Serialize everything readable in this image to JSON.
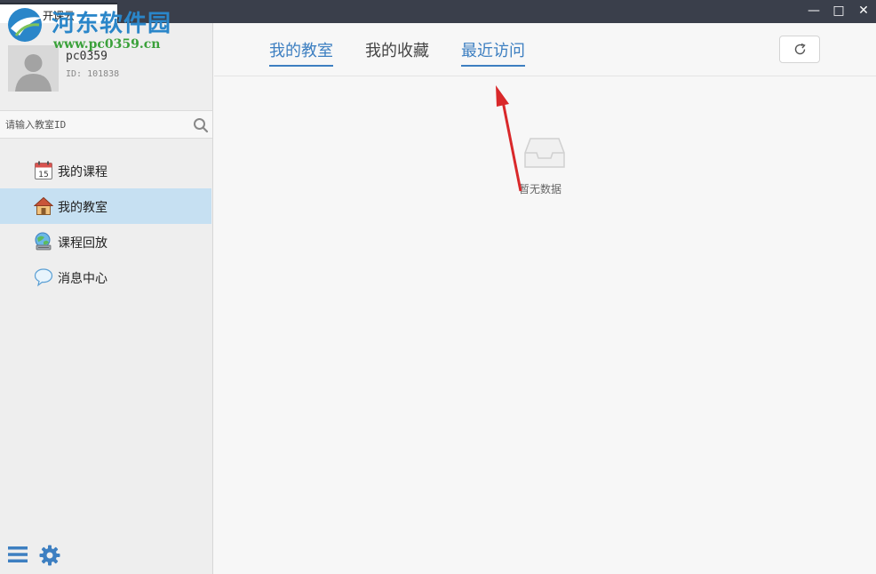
{
  "window": {
    "title": "开课云",
    "minimize_glyph": "—",
    "maximize_glyph": "□",
    "close_glyph": "✕"
  },
  "watermark": {
    "site_name": "河东软件园",
    "url": "www.pc0359.cn"
  },
  "user": {
    "name": "pc0359",
    "id_text": "ID: 101838"
  },
  "search": {
    "placeholder": "请输入教室ID",
    "value": ""
  },
  "sidebar": {
    "items": [
      {
        "label": "我的课程",
        "icon": "calendar-icon",
        "active": false
      },
      {
        "label": "我的教室",
        "icon": "house-icon",
        "active": true
      },
      {
        "label": "课程回放",
        "icon": "playback-icon",
        "active": false
      },
      {
        "label": "消息中心",
        "icon": "message-bubble-icon",
        "active": false
      }
    ],
    "calendar_day": "15"
  },
  "tabs": [
    {
      "label": "我的教室",
      "active": true
    },
    {
      "label": "我的收藏",
      "active": false
    },
    {
      "label": "最近访问",
      "active": true
    }
  ],
  "empty_state": {
    "text": "暂无数据"
  },
  "colors": {
    "accent": "#3d7fc1",
    "active_nav_bg": "#c6e0f2",
    "titlebar": "#3a3f4b",
    "annotation_arrow": "#d9282a"
  }
}
